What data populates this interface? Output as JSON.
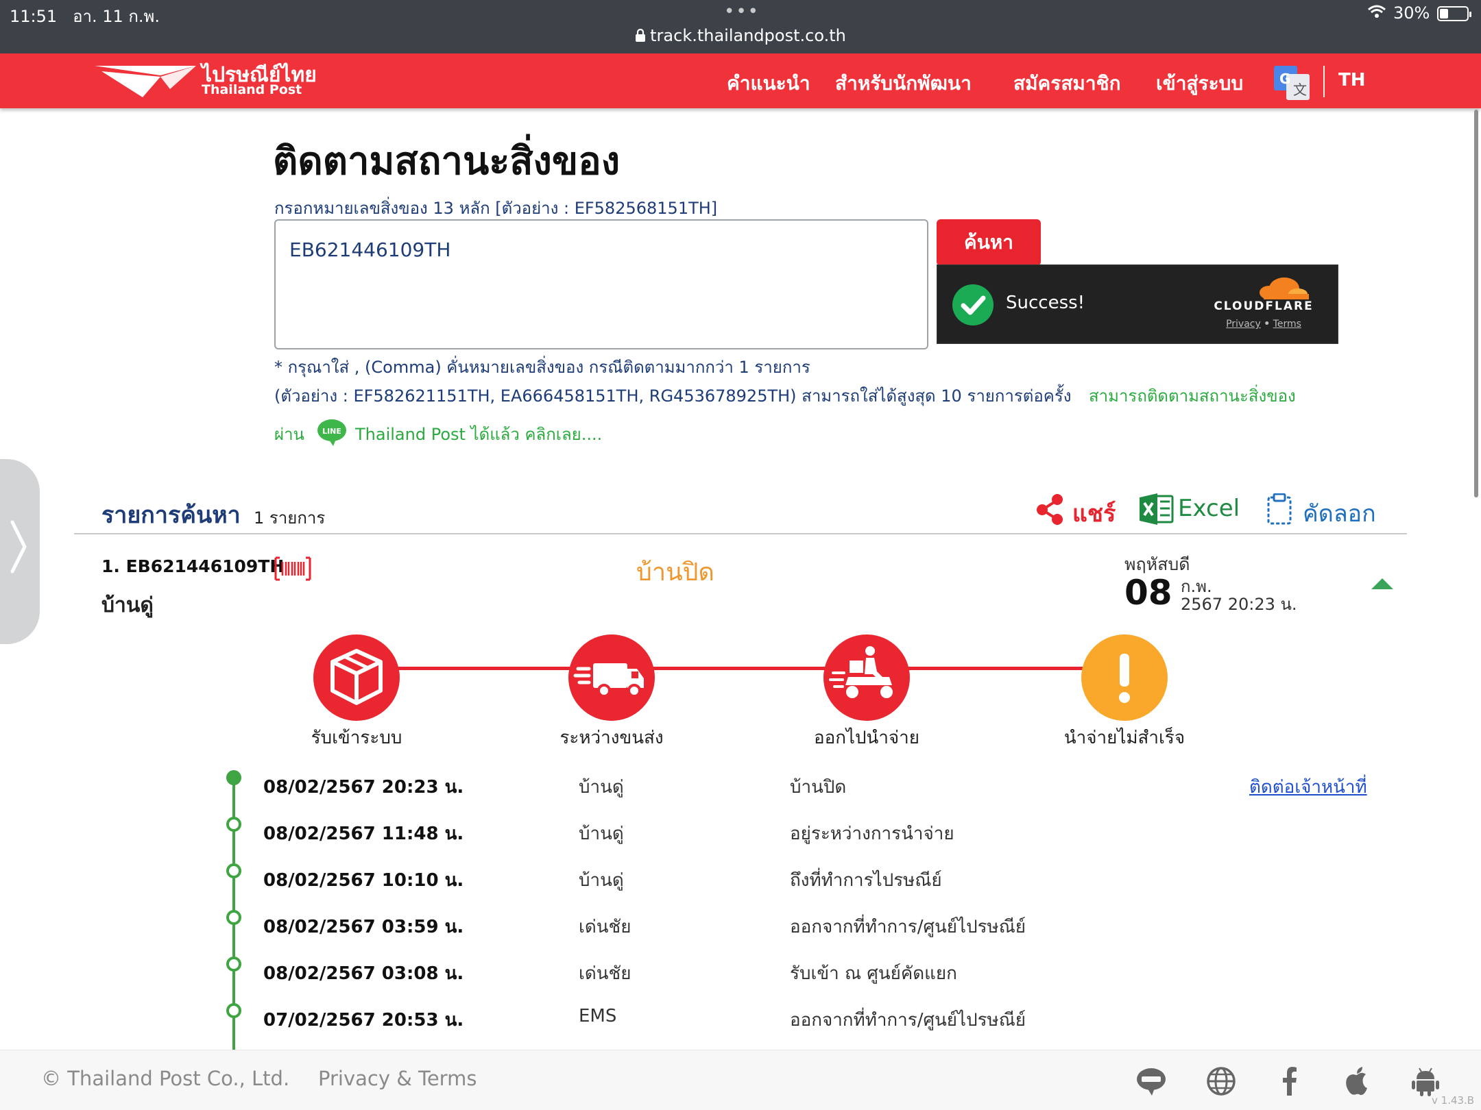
{
  "status_bar": {
    "time": "11:51",
    "date": "อา. 11 ก.พ.",
    "dots": "•••",
    "url": "track.thailandpost.co.th",
    "battery": "30%"
  },
  "header": {
    "logo_th": "ไปรษณีย์ไทย",
    "logo_en": "Thailand Post",
    "nav": [
      "คำแนะนำ",
      "สำหรับนักพัฒนา",
      "สมัครสมาชิก",
      "เข้าสู่ระบบ"
    ],
    "lang": "TH",
    "brand_color": "#f0323b"
  },
  "search": {
    "title": "ติดตามสถานะสิ่งของ",
    "hint": "กรอกหมายเลขสิ่งของ 13 หลัก [ตัวอย่าง : EF582568151TH]",
    "input_value": "EB621446109TH",
    "button_label": "ค้นหา",
    "note1": "* กรุณาใส่ , (Comma) คั่นหมายเลขสิ่งของ กรณีติดตามมากกว่า 1 รายการ",
    "note2": "(ตัวอย่าง : EF582621151TH, EA666458151TH, RG453678925TH) สามารถใส่ได้สูงสุด 10 รายการต่อครั้ง",
    "note2_green": "สามารถติดตามสถานะสิ่งของ",
    "note3_prefix": "ผ่าน",
    "note3_link": "Thailand Post ได้แล้ว คลิกเลย....",
    "line_badge": "LINE"
  },
  "captcha": {
    "status": "Success!",
    "brand": "CLOUDFLARE",
    "privacy": "Privacy",
    "sep": "•",
    "terms": "Terms"
  },
  "results": {
    "title": "รายการค้นหา",
    "count": "1 รายการ",
    "share": "แชร์",
    "excel": "Excel",
    "copy": "คัดลอก"
  },
  "item": {
    "number": "1. EB621446109TH",
    "place": "บ้านดู่",
    "status": "บ้านปิด",
    "day": "พฤหัสบดี",
    "date": "08",
    "month": "ก.พ.",
    "year_time": "2567 20:23 น."
  },
  "steps": [
    {
      "label": "รับเข้าระบบ",
      "icon": "box-icon"
    },
    {
      "label": "ระหว่างขนส่ง",
      "icon": "truck-icon"
    },
    {
      "label": "ออกไปนำจ่าย",
      "icon": "scooter-icon"
    },
    {
      "label": "นำจ่ายไม่สำเร็จ",
      "icon": "exclamation-icon"
    }
  ],
  "timeline": [
    {
      "date": "08/02/2567 20:23 น.",
      "location": "บ้านดู่",
      "description": "บ้านปิด"
    },
    {
      "date": "08/02/2567 11:48 น.",
      "location": "บ้านดู่",
      "description": "อยู่ระหว่างการนำจ่าย"
    },
    {
      "date": "08/02/2567 10:10 น.",
      "location": "บ้านดู่",
      "description": "ถึงที่ทำการไปรษณีย์"
    },
    {
      "date": "08/02/2567 03:59 น.",
      "location": "เด่นชัย",
      "description": "ออกจากที่ทำการ/ศูนย์ไปรษณีย์"
    },
    {
      "date": "08/02/2567 03:08 น.",
      "location": "เด่นชัย",
      "description": "รับเข้า ณ ศูนย์คัดแยก"
    },
    {
      "date": "07/02/2567 20:53 น.",
      "location": "EMS",
      "description": "ออกจากที่ทำการ/ศูนย์ไปรษณีย์"
    }
  ],
  "contact_link": "ติดต่อเจ้าหน้าที่",
  "footer": {
    "copyright": "© Thailand Post Co., Ltd.",
    "privacy": "Privacy & Terms",
    "version": "v 1.43.B"
  }
}
